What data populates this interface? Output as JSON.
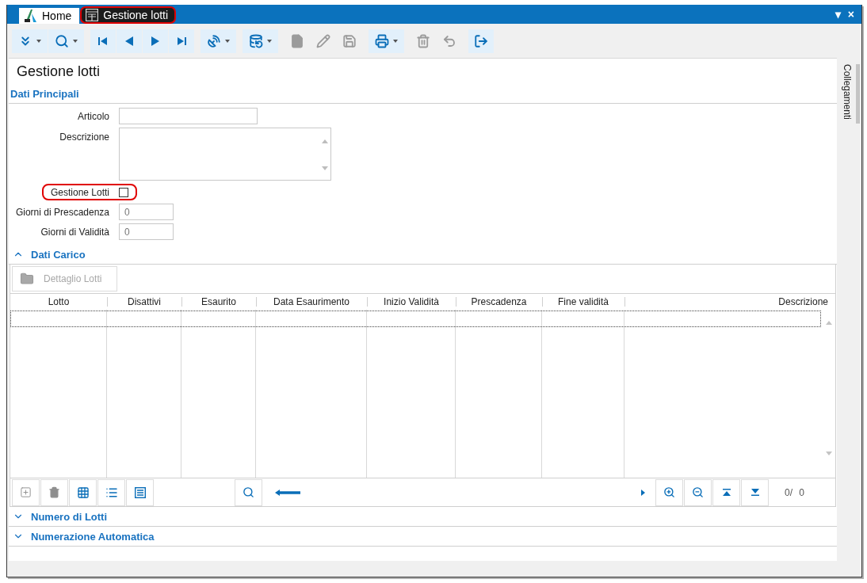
{
  "window": {
    "tabs": [
      {
        "label": "Home",
        "selected": false,
        "highlighted": false
      },
      {
        "label": "Gestione lotti",
        "selected": true,
        "highlighted": true
      }
    ],
    "controls": [
      "▾",
      "×"
    ]
  },
  "toolbar": {
    "groups": [
      [
        {
          "disabled": false,
          "dropdown": true
        },
        {
          "disabled": false,
          "dropdown": true
        }
      ],
      [
        {
          "disabled": false,
          "dropdown": false
        },
        {
          "disabled": false,
          "dropdown": false
        },
        {
          "disabled": false,
          "dropdown": false
        },
        {
          "disabled": false,
          "dropdown": false
        }
      ],
      [
        {
          "disabled": false,
          "dropdown": true
        }
      ],
      [
        {
          "disabled": false,
          "dropdown": true
        }
      ],
      [
        {
          "disabled": true,
          "dropdown": false
        },
        {
          "disabled": true,
          "dropdown": false
        },
        {
          "disabled": true,
          "dropdown": false
        }
      ],
      [
        {
          "disabled": false,
          "dropdown": true
        }
      ],
      [
        {
          "disabled": true,
          "dropdown": false
        },
        {
          "disabled": true,
          "dropdown": false
        }
      ],
      [
        {
          "disabled": false,
          "dropdown": false
        }
      ]
    ]
  },
  "page": {
    "title": "Gestione lotti"
  },
  "main_section": {
    "title": "Dati Principali",
    "fields": [
      {
        "kind": "text",
        "label": "Articolo",
        "highlighted": false
      },
      {
        "kind": "textarea",
        "label": "Descrizione",
        "highlighted": false
      },
      {
        "kind": "checkbox",
        "label": "Gestione Lotti",
        "checked": false,
        "highlighted": true
      },
      {
        "kind": "number",
        "label": "Giorni di Prescadenza",
        "value": "0",
        "highlighted": false
      },
      {
        "kind": "number",
        "label": "Giorni di Validità",
        "value": "0",
        "highlighted": false
      }
    ]
  },
  "load_section": {
    "title": "Dati Carico",
    "expanded": true,
    "detail_button": {
      "label": "Dettaglio Lotti",
      "disabled": true
    },
    "table": {
      "columns": [
        "Lotto",
        "Disattivi",
        "Esaurito",
        "Data Esaurimento",
        "Inizio Validità",
        "Prescadenza",
        "Fine validità",
        "Descrizione"
      ],
      "focused_new_row": true
    },
    "grid_toolbar": {
      "left_buttons": [
        {
          "disabled": true
        },
        {
          "disabled": true
        },
        {
          "disabled": false
        },
        {
          "disabled": false
        },
        {
          "disabled": false
        }
      ],
      "counter": "0/ 0"
    }
  },
  "other_sections": [
    {
      "title": "Numero di Lotti",
      "expanded": false
    },
    {
      "title": "Numerazione Automatica",
      "expanded": false
    }
  ],
  "side_panel": {
    "title": "Collegamenti"
  }
}
